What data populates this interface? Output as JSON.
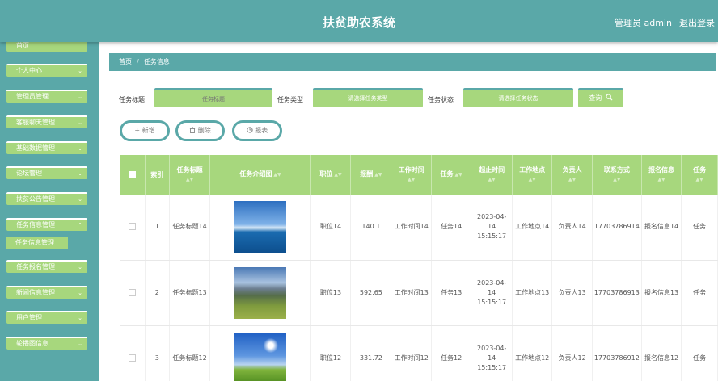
{
  "header": {
    "title": "扶贫助农系统",
    "user": "管理员 admin",
    "logout": "退出登录"
  },
  "sidebar": {
    "items": [
      {
        "label": "首页"
      },
      {
        "label": "个人中心"
      },
      {
        "label": "管理员管理"
      },
      {
        "label": "客服聊天管理"
      },
      {
        "label": "基础数据管理"
      },
      {
        "label": "论坛管理"
      },
      {
        "label": "扶贫公告管理"
      },
      {
        "label": "任务信息管理"
      },
      {
        "label": "任务报名管理"
      },
      {
        "label": "新闻信息管理"
      },
      {
        "label": "用户管理"
      },
      {
        "label": "轮播图信息"
      }
    ],
    "sub_item": {
      "label": "任务信息管理"
    }
  },
  "breadcrumb": {
    "home": "首页",
    "separator": "/",
    "current": "任务信息"
  },
  "search": {
    "title_label": "任务标题",
    "title_placeholder": "任务标题",
    "type_label": "任务类型",
    "type_placeholder": "请选择任务类型",
    "status_label": "任务状态",
    "status_placeholder": "请选择任务状态",
    "query_label": "查询"
  },
  "actions": {
    "add": "新增",
    "delete": "删除",
    "report": "报表"
  },
  "table": {
    "headers": [
      "索引",
      "任务标题",
      "任务介绍图",
      "职位",
      "报酬",
      "工作时间",
      "任务",
      "起止时间",
      "工作地点",
      "负责人",
      "联系方式",
      "报名信息",
      "任务"
    ],
    "rows": [
      {
        "index": "1",
        "title": "任务标题14",
        "position": "职位14",
        "pay": "140.1",
        "worktime": "工作时间14",
        "task": "任务14",
        "period": "2023-04-14 15:15:17",
        "place": "工作地点14",
        "owner": "负责人14",
        "contact": "17703786914",
        "signup": "报名信息14",
        "extra": "任务"
      },
      {
        "index": "2",
        "title": "任务标题13",
        "position": "职位13",
        "pay": "592.65",
        "worktime": "工作时间13",
        "task": "任务13",
        "period": "2023-04-14 15:15:17",
        "place": "工作地点13",
        "owner": "负责人13",
        "contact": "17703786913",
        "signup": "报名信息13",
        "extra": "任务"
      },
      {
        "index": "3",
        "title": "任务标题12",
        "position": "职位12",
        "pay": "331.72",
        "worktime": "工作时间12",
        "task": "任务12",
        "period": "2023-04-14 15:15:17",
        "place": "工作地点12",
        "owner": "负责人12",
        "contact": "17703786912",
        "signup": "报名信息12",
        "extra": "任务"
      }
    ]
  },
  "colors": {
    "primary": "#5aa8a8",
    "accent": "#a7d77d",
    "background": "#ffffff"
  }
}
